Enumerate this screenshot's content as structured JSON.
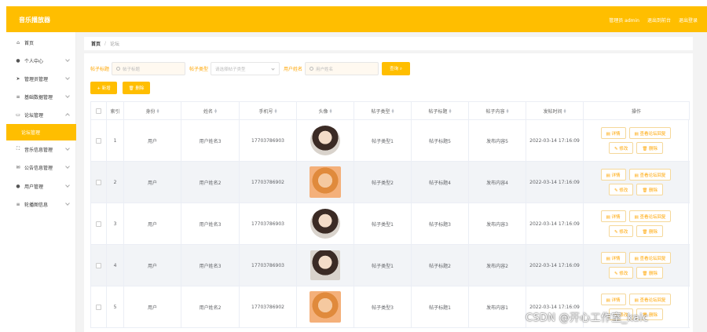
{
  "header": {
    "app_title": "音乐播放器",
    "admin_label": "管理员 admin",
    "exit_to_front": "退出到前台",
    "logout": "退出登录"
  },
  "sidebar": {
    "items": [
      {
        "label": "首页",
        "icon": "home-icon",
        "glyph": "⌂"
      },
      {
        "label": "个人中心",
        "icon": "user-icon",
        "glyph": "●"
      },
      {
        "label": "管理员管理",
        "icon": "send-icon",
        "glyph": "➤"
      },
      {
        "label": "基础数据管理",
        "icon": "list-icon",
        "glyph": "≡"
      },
      {
        "label": "论坛管理",
        "icon": "chat-icon",
        "glyph": "▭"
      },
      {
        "label": "音乐信息管理",
        "icon": "expand-icon",
        "glyph": "⛶"
      },
      {
        "label": "公告信息管理",
        "icon": "mail-icon",
        "glyph": "✉"
      },
      {
        "label": "用户管理",
        "icon": "person-icon",
        "glyph": "●"
      },
      {
        "label": "轮播图信息",
        "icon": "menu-icon",
        "glyph": "≡"
      }
    ],
    "active_sub": "论坛管理"
  },
  "breadcrumb": {
    "home": "首页",
    "separator": "/",
    "current": "论坛"
  },
  "search": {
    "title_label": "帖子标题",
    "title_placeholder": "帖子标题",
    "type_label": "帖子类型",
    "type_placeholder": "请选择帖子类型",
    "user_label": "用户姓名",
    "user_placeholder": "用户姓名",
    "query_button": "查询 ⌕"
  },
  "actions": {
    "add": "+ 新增",
    "delete": "🗑 删除"
  },
  "table": {
    "headers": [
      "索引",
      "身份",
      "姓名",
      "手机号",
      "头像",
      "帖子类型",
      "帖子标题",
      "帖子内容",
      "发帖时间",
      "操作"
    ],
    "rows": [
      {
        "index": "1",
        "identity": "用户",
        "name": "用户姓名3",
        "phone": "17703786903",
        "type": "帖子类型1",
        "title": "帖子标题5",
        "content": "发布内容5",
        "time": "2022-03-14 17:16:09"
      },
      {
        "index": "2",
        "identity": "用户",
        "name": "用户姓名2",
        "phone": "17703786902",
        "type": "帖子类型2",
        "title": "帖子标题4",
        "content": "发布内容4",
        "time": "2022-03-14 17:16:09"
      },
      {
        "index": "3",
        "identity": "用户",
        "name": "用户姓名3",
        "phone": "17703786903",
        "type": "帖子类型1",
        "title": "帖子标题3",
        "content": "发布内容3",
        "time": "2022-03-14 17:16:09"
      },
      {
        "index": "4",
        "identity": "用户",
        "name": "用户姓名3",
        "phone": "17703786903",
        "type": "帖子类型1",
        "title": "帖子标题2",
        "content": "发布内容2",
        "time": "2022-03-14 17:16:09"
      },
      {
        "index": "5",
        "identity": "用户",
        "name": "用户姓名2",
        "phone": "17703786902",
        "type": "帖子类型3",
        "title": "帖子标题1",
        "content": "发布内容1",
        "time": "2022-03-14 17:16:09"
      }
    ],
    "op_labels": {
      "detail": "▤ 详情",
      "view_reply": "▤ 查看论坛回复",
      "edit": "✎ 修改",
      "delete": "🗑 删除"
    }
  },
  "watermark": "CSDN @开心工作室_kaic",
  "colors": {
    "accent": "#ffbe00",
    "accent_text": "#ffa500"
  }
}
